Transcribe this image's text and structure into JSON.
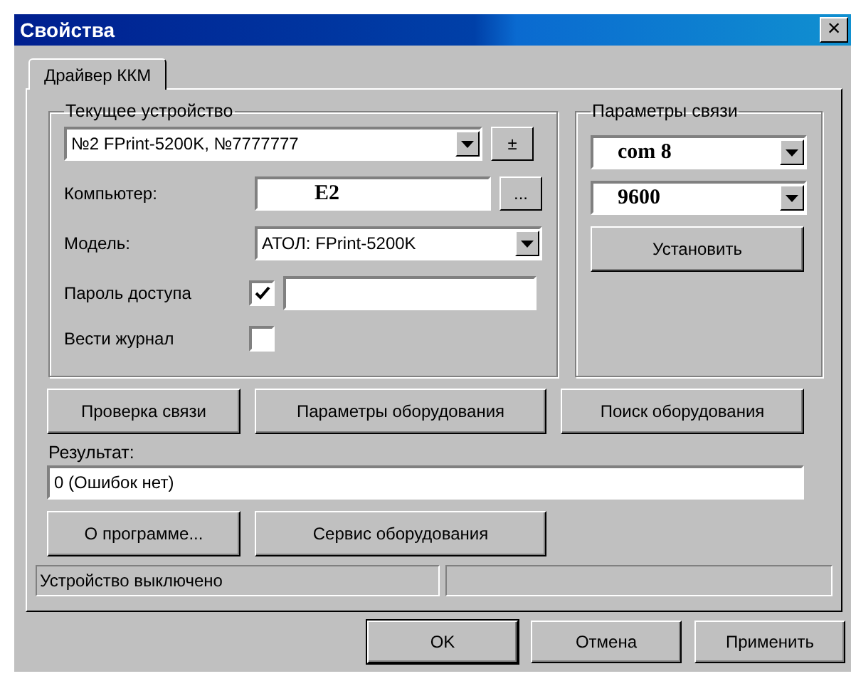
{
  "window": {
    "title": "Свойства",
    "close": "×"
  },
  "tabs": [
    {
      "label": "Драйвер ККМ",
      "selected": true
    }
  ],
  "device_group": {
    "title": "Текущее устройство",
    "device": {
      "value": "№2 FPrint-5200K, №7777777"
    },
    "plus_minus": "±",
    "computer": {
      "label": "Компьютер:",
      "value": "E2",
      "browse": "..."
    },
    "model": {
      "label": "Модель:",
      "value": "АТОЛ: FPrint-5200K"
    },
    "password": {
      "label": "Пароль доступа",
      "checked": true
    },
    "log": {
      "label": "Вести журнал",
      "checked": false
    }
  },
  "connection_group": {
    "title": "Параметры связи",
    "port": {
      "value": "com 8"
    },
    "speed": {
      "value": "9600"
    },
    "set_button": "Установить"
  },
  "action_buttons": [
    "Проверка связи",
    "Параметры оборудования",
    "Поиск оборудования"
  ],
  "result": {
    "label": "Результат:",
    "value": "0 (Ошибок нет)"
  },
  "lower_buttons": [
    "О программе...",
    "Сервис оборудования"
  ],
  "status_bar": [
    "Устройство выключено"
  ],
  "buttons": [
    {
      "label": "OK",
      "default": true
    },
    {
      "label": "Отмена",
      "default": false
    },
    {
      "label": "Применить",
      "default": false
    }
  ]
}
